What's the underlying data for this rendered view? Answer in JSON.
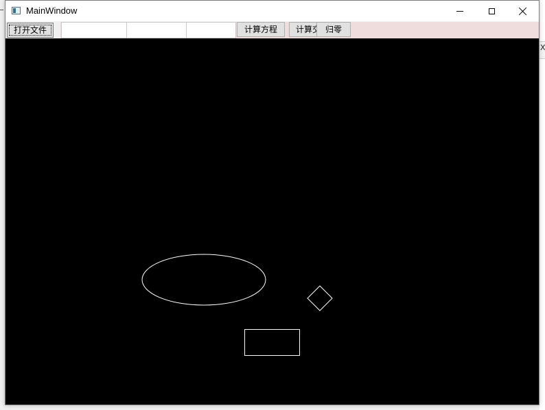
{
  "window": {
    "title": "MainWindow"
  },
  "toolbar": {
    "open_file_label": "打开文件",
    "input1_value": "",
    "input2_value": "",
    "input3_value": "",
    "calc_equation_label": "计算方程",
    "calc_partial_label": "计算交",
    "reset_label": "归零"
  },
  "background": {
    "right_edge_text": "X"
  },
  "canvas": {
    "background_color": "#000000",
    "stroke_color": "#ffffff",
    "shapes": [
      "ellipse",
      "diamond",
      "rectangle"
    ]
  }
}
